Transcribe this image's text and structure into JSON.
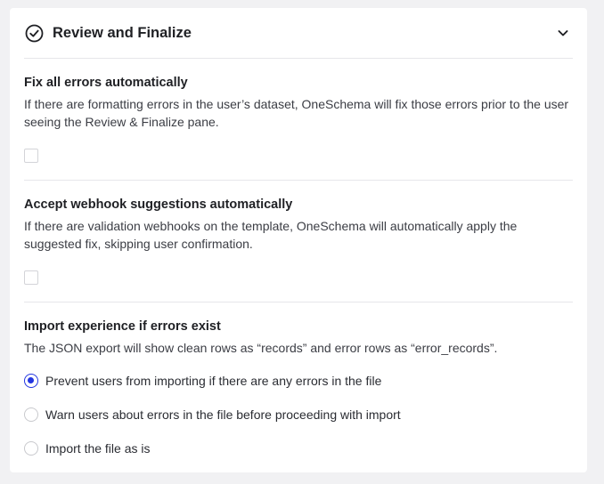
{
  "header": {
    "title": "Review and Finalize"
  },
  "sections": [
    {
      "title": "Fix all errors automatically",
      "description": "If there are formatting errors in the user’s dataset, OneSchema will fix those errors prior to the user seeing the Review & Finalize pane.",
      "checked": false
    },
    {
      "title": "Accept webhook suggestions automatically",
      "description": "If there are validation webhooks on the template, OneSchema will automatically apply the suggested fix, skipping user confirmation.",
      "checked": false
    },
    {
      "title": "Import experience if errors exist",
      "description": "The JSON export will show clean rows as “records” and error rows as “error_records”.",
      "options": [
        {
          "label": "Prevent users from importing if there are any errors in the file",
          "selected": true
        },
        {
          "label": "Warn users about errors in the file before proceeding with import",
          "selected": false
        },
        {
          "label": "Import the file as is",
          "selected": false
        }
      ]
    }
  ],
  "colors": {
    "accent": "#2336e0",
    "background": "#f1f1f3",
    "card": "#ffffff",
    "divider": "#e6e6ea"
  },
  "icons": {
    "header": "check-circle-icon",
    "collapse": "chevron-down-icon"
  }
}
